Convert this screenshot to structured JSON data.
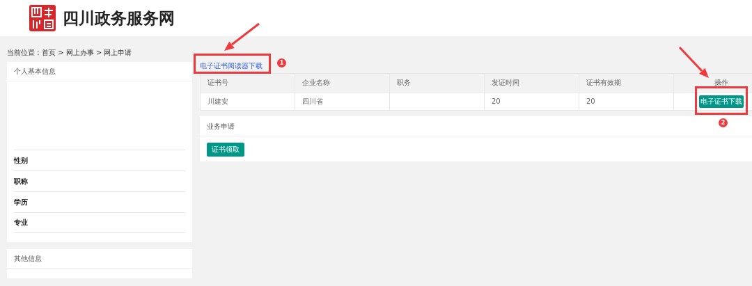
{
  "header": {
    "site_title": "四川政务服务网"
  },
  "breadcrumb": "当前位置：首页 > 网上办事 > 网上申请",
  "personal_info": {
    "title": "个人基本信息",
    "fields": [
      {
        "label": "性别"
      },
      {
        "label": "职称"
      },
      {
        "label": "学历"
      },
      {
        "label": "专业"
      }
    ]
  },
  "other_info": {
    "title": "其他信息"
  },
  "reader_download_link": "电子证书阅读器下载",
  "table": {
    "columns": [
      "证书号",
      "企业名称",
      "职务",
      "发证时间",
      "证书有效期",
      "操作"
    ],
    "rows": [
      {
        "cells": [
          "川建安",
          "四川省",
          "",
          "20",
          "20"
        ],
        "action": "电子证书下载"
      }
    ]
  },
  "business": {
    "title": "业务申请",
    "button": "证书领取"
  },
  "annotations": [
    {
      "number": "1"
    },
    {
      "number": "2"
    }
  ]
}
